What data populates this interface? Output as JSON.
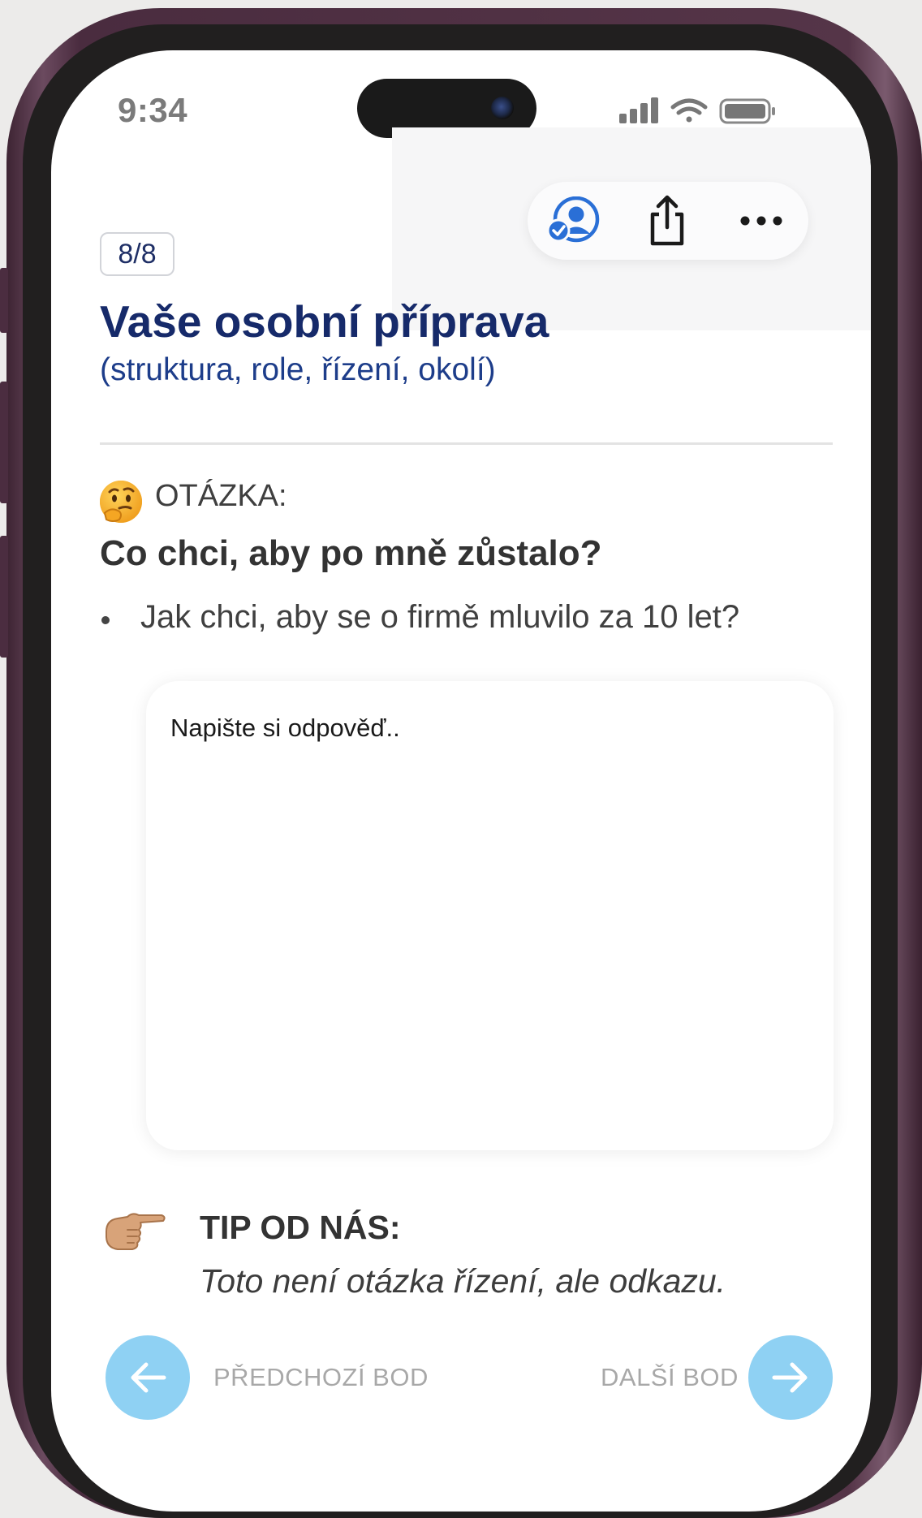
{
  "status_bar": {
    "time": "9:34"
  },
  "toolbar": {
    "profile_icon": "user-check-icon",
    "share_icon": "share-icon",
    "more_icon": "more-dots-icon"
  },
  "progress": {
    "label": "8/8"
  },
  "section": {
    "title": "Vaše osobní příprava",
    "subtitle": "(struktura, role, řízení, okolí)"
  },
  "question": {
    "label": "OTÁZKA:",
    "emoji": "thinking-face-icon",
    "text": "Co chci, aby po mně zůstalo?",
    "bullets": [
      "Jak chci, aby se o firmě mluvilo za 10 let?"
    ]
  },
  "answer": {
    "placeholder": "Napište si odpověď..",
    "value": ""
  },
  "tip": {
    "label": "TIP OD NÁS:",
    "text": "Toto není otázka řízení, ale odkazu.",
    "icon": "pointing-hand-icon"
  },
  "navigation": {
    "prev_label": "PŘEDCHOZÍ BOD",
    "next_label": "DALŠÍ BOD"
  },
  "colors": {
    "title": "#162a6a",
    "subtitle": "#1d3d8a",
    "nav_button": "#8fd1f3",
    "profile_icon": "#2a6fd6",
    "frame": "#553548"
  }
}
